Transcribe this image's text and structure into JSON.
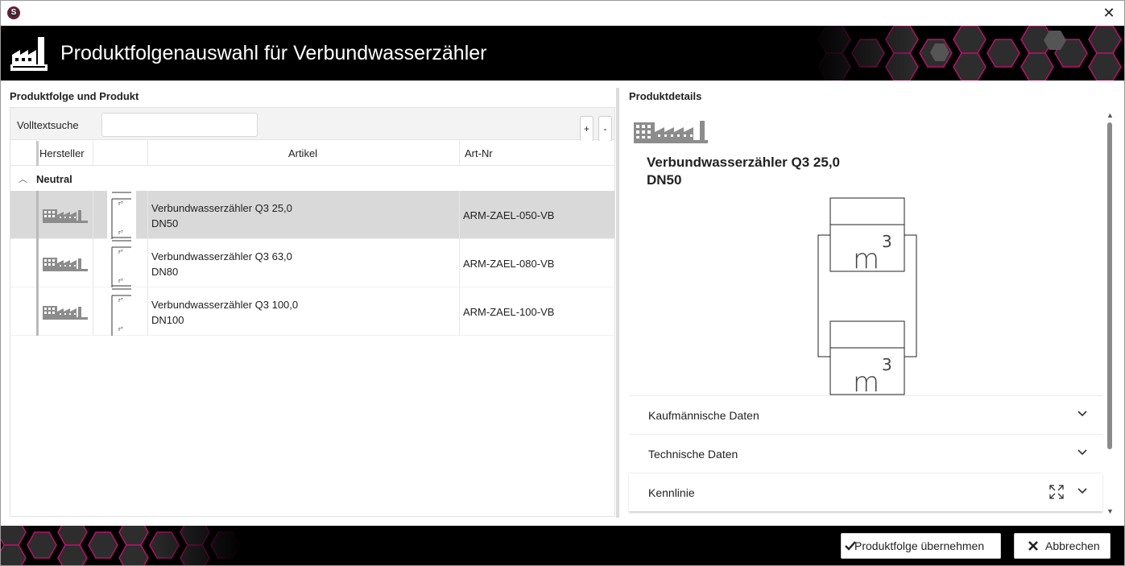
{
  "window": {
    "app_icon_letter": "S",
    "close_glyph": "✕"
  },
  "header": {
    "title": "Produktfolgenauswahl für Verbundwasserzähler",
    "icon": "factory-icon"
  },
  "left_panel": {
    "title": "Produktfolge und Produkt",
    "search": {
      "label": "Volltextsuche",
      "value": "",
      "placeholder": ""
    },
    "expand_all_label": "+",
    "collapse_all_label": "-",
    "columns": {
      "hersteller": "Hersteller",
      "image": "",
      "artikel": "Artikel",
      "art_nr": "Art-Nr"
    },
    "group": {
      "label": "Neutral",
      "expanded": true
    },
    "rows": [
      {
        "artikel_line1": "Verbundwasserzähler Q3 25,0",
        "artikel_line2": "DN50",
        "art_nr": "ARM-ZAEL-050-VB",
        "selected": true
      },
      {
        "artikel_line1": "Verbundwasserzähler Q3 63,0",
        "artikel_line2": "DN80",
        "art_nr": "ARM-ZAEL-080-VB",
        "selected": false
      },
      {
        "artikel_line1": "Verbundwasserzähler Q3 100,0",
        "artikel_line2": "DN100",
        "art_nr": "ARM-ZAEL-100-VB",
        "selected": false
      }
    ]
  },
  "right_panel": {
    "title": "Produktdetails",
    "product_name_line1": "Verbundwasserzähler Q3 25,0",
    "product_name_line2": "DN50",
    "schematic_unit": "m",
    "schematic_exponent": "3",
    "sections": [
      {
        "label": "Kaufmännische Daten"
      },
      {
        "label": "Technische Daten"
      },
      {
        "label": "Kennlinie"
      }
    ]
  },
  "footer": {
    "accept_label": "Produktfolge übernehmen",
    "cancel_label": "Abbrechen"
  },
  "colors": {
    "header_bg": "#000000",
    "hex_accent": "#c0136e",
    "selected_row": "#d9d9d9"
  }
}
